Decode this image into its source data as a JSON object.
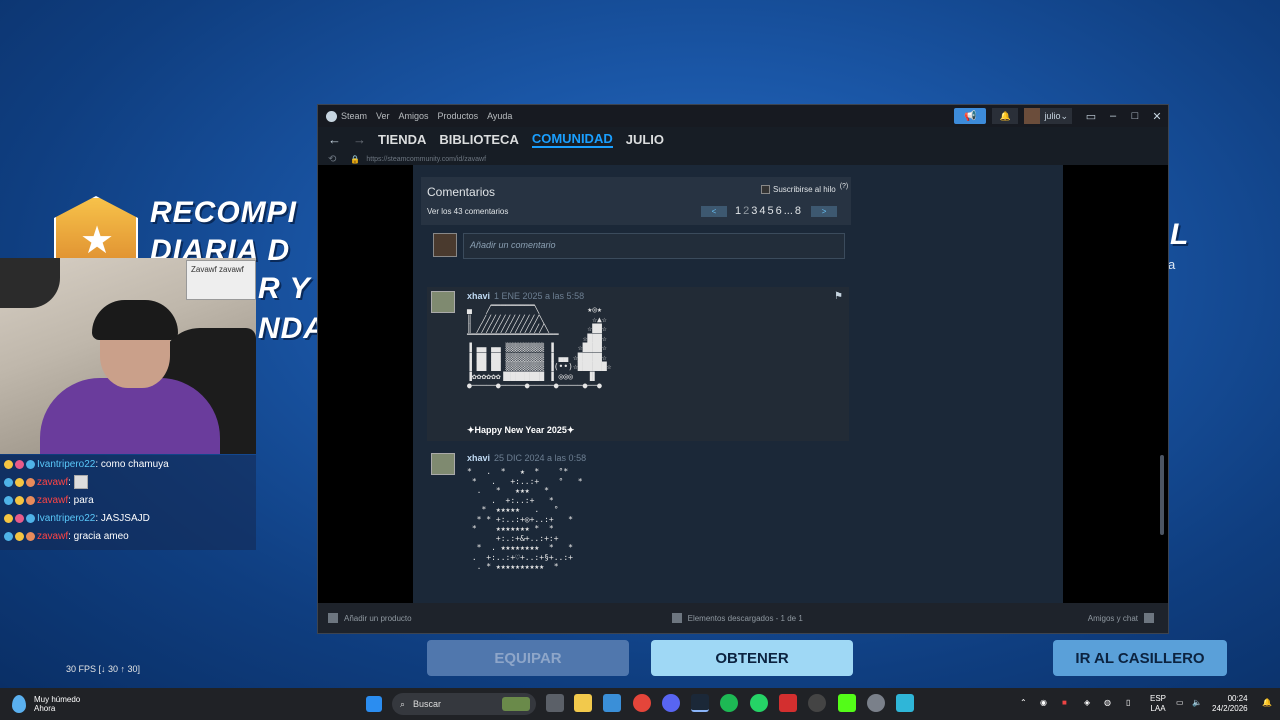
{
  "game": {
    "banner_lines": [
      "RECOMPI",
      "DIARIA D",
      "R Y",
      "NDA"
    ],
    "right_banner_letter": "L",
    "right_banner_small": "a",
    "buttons": {
      "equipar": "EQUIPAR",
      "obtener": "OBTENER",
      "casillero": "IR AL CASILLERO"
    },
    "fps": "30 FPS [↓ 30 ↑ 30]"
  },
  "webcam": {
    "poster_text": "Zavawf zavawf"
  },
  "chat": [
    {
      "user": "Ivantripero22",
      "text": ": como chamuya",
      "color": "#5ac8fa"
    },
    {
      "user": "zavawf",
      "text": ":",
      "color": "#ff4444",
      "emote": true
    },
    {
      "user": "zavawf",
      "text": ": para",
      "color": "#ff4444"
    },
    {
      "user": "Ivantripero22",
      "text": ": JASJSAJD",
      "color": "#5ac8fa"
    },
    {
      "user": "zavawf",
      "text": ": gracia ameo",
      "color": "#ff4444"
    }
  ],
  "steam": {
    "menu": [
      "Steam",
      "Ver",
      "Amigos",
      "Productos",
      "Ayuda"
    ],
    "username": "julio",
    "tabs": [
      "TIENDA",
      "BIBLIOTECA",
      "COMUNIDAD",
      "JULIO"
    ],
    "active_tab": "COMUNIDAD",
    "url": "https://steamcommunity.com/id/zavawf",
    "comments": {
      "title": "Comentarios",
      "subscribe": "Suscribirse al hilo",
      "help": "(?)",
      "view_all": "Ver los 43 comentarios",
      "pages": [
        "1",
        "2",
        "3",
        "4",
        "5",
        "6",
        "...",
        "8"
      ],
      "add_placeholder": "Añadir un comentario",
      "entries": [
        {
          "author": "xhavi",
          "date": "1 ENE 2025 a las 5:58",
          "message": "✦Happy New Year 2025✦"
        },
        {
          "author": "xhavi",
          "date": "25 DIC 2024 a las 0:58",
          "message": ""
        }
      ]
    },
    "status": {
      "add_product": "Añadir un producto",
      "downloads": "Elementos descargados - 1 de 1",
      "friends": "Amigos y chat"
    }
  },
  "taskbar": {
    "weather_title": "Muy húmedo",
    "weather_sub": "Ahora",
    "search": "Buscar",
    "lang1": "ESP",
    "lang2": "LAA",
    "time": "00:24",
    "date": "24/2/2026"
  }
}
